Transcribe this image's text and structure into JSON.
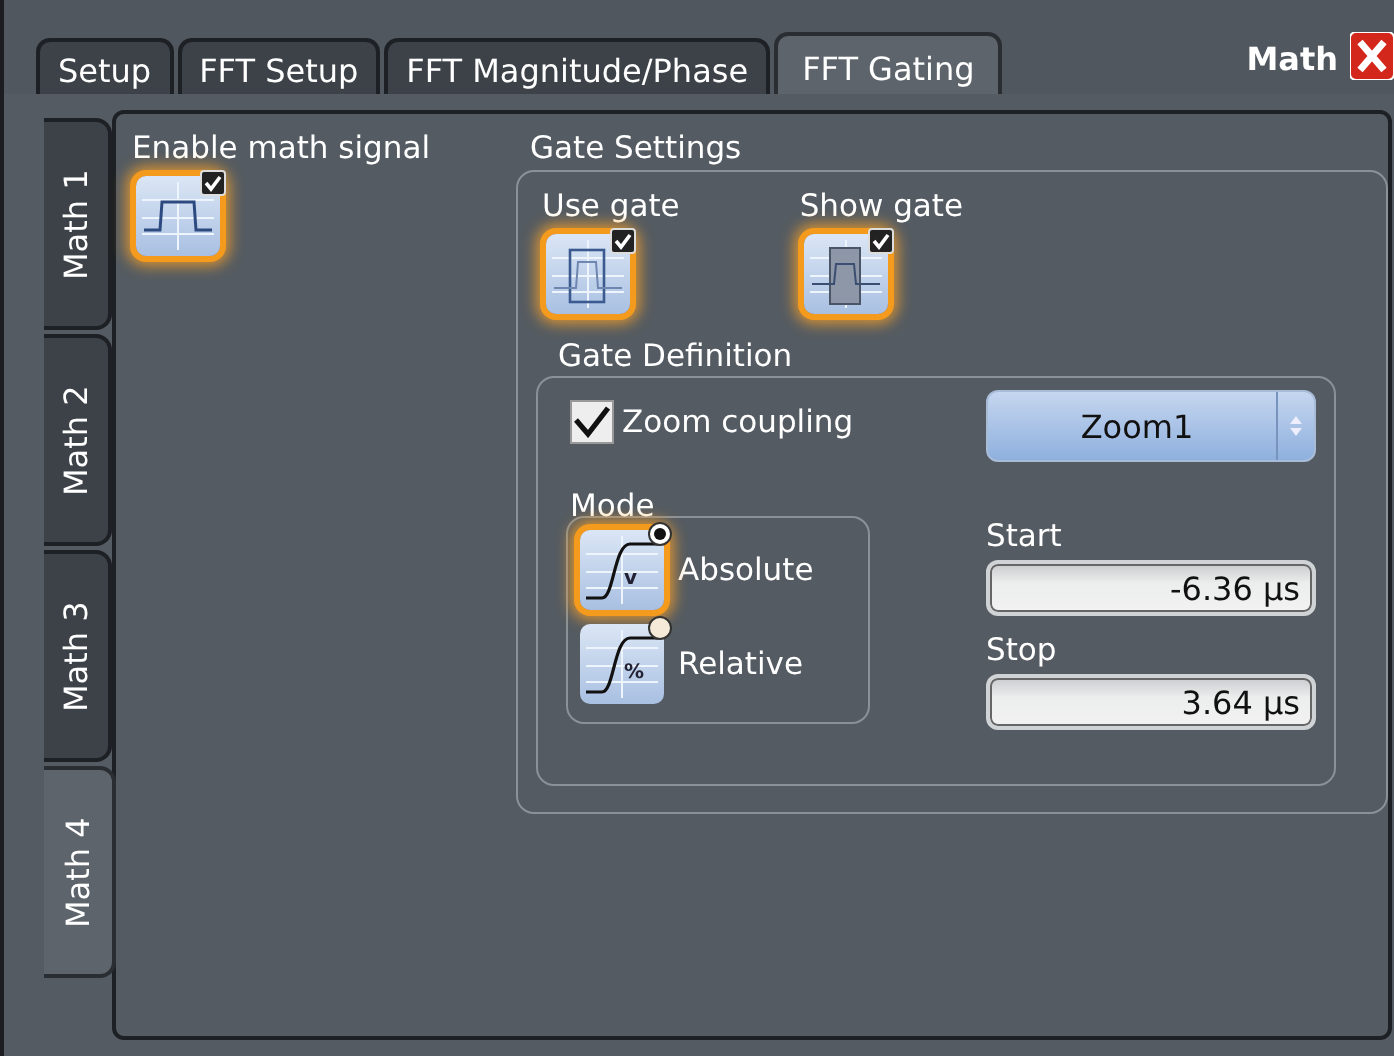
{
  "window": {
    "title": "Math"
  },
  "tabs": [
    {
      "label": "Setup",
      "selected": false
    },
    {
      "label": "FFT Setup",
      "selected": false
    },
    {
      "label": "FFT Magnitude/Phase",
      "selected": false
    },
    {
      "label": "FFT Gating",
      "selected": true
    }
  ],
  "math_tabs": [
    {
      "label": "Math 1",
      "selected": false
    },
    {
      "label": "Math 2",
      "selected": false
    },
    {
      "label": "Math 3",
      "selected": false
    },
    {
      "label": "Math 4",
      "selected": true
    }
  ],
  "enable_math_signal": {
    "label": "Enable math signal",
    "checked": true
  },
  "gate_settings": {
    "title": "Gate Settings",
    "use_gate": {
      "label": "Use gate",
      "checked": true
    },
    "show_gate": {
      "label": "Show gate",
      "checked": true
    },
    "gate_definition": {
      "title": "Gate Definition",
      "zoom_coupling": {
        "label": "Zoom coupling",
        "checked": true
      },
      "zoom_select": {
        "value": "Zoom1"
      },
      "mode": {
        "title": "Mode",
        "options": [
          {
            "label": "Absolute",
            "symbol": "v",
            "selected": true
          },
          {
            "label": "Relative",
            "symbol": "%",
            "selected": false
          }
        ]
      },
      "start": {
        "label": "Start",
        "value": "-6.36 µs"
      },
      "stop": {
        "label": "Stop",
        "value": "3.64 µs"
      }
    }
  }
}
